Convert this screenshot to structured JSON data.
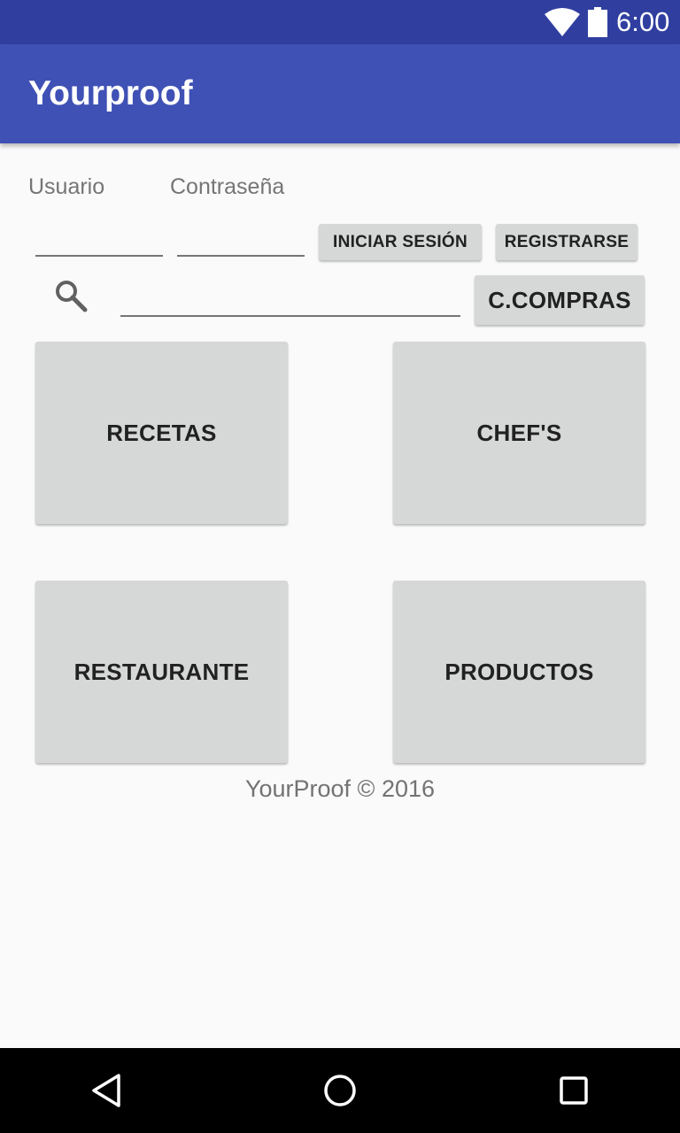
{
  "status_bar": {
    "time": "6:00",
    "icons": [
      "wifi-icon",
      "battery-icon"
    ]
  },
  "app_bar": {
    "title": "Yourproof"
  },
  "login": {
    "user_label": "Usuario",
    "password_label": "Contraseña",
    "user_value": "",
    "password_value": "",
    "login_button": "INICIAR SESIÓN",
    "register_button": "REGISTRARSE"
  },
  "search": {
    "icon": "search-icon",
    "value": "",
    "cart_button": "C.COMPRAS"
  },
  "tiles": {
    "recetas": "RECETAS",
    "chefs": "CHEF'S",
    "restaurante": "RESTAURANTE",
    "productos": "PRODUCTOS"
  },
  "footer": {
    "text": "YourProof © 2016"
  },
  "nav_bar": {
    "icons": [
      "back-icon",
      "home-icon",
      "recents-icon"
    ]
  },
  "colors": {
    "status_bar": "#303f9f",
    "app_bar": "#3f51b5",
    "button": "#d6d7d7",
    "background": "#fafafa"
  }
}
